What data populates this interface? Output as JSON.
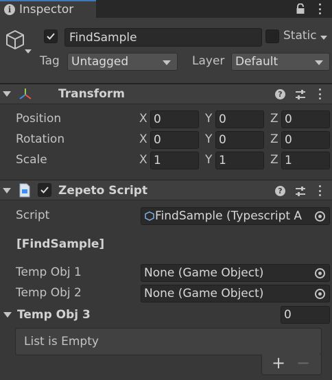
{
  "tab": {
    "title": "Inspector"
  },
  "header": {
    "object_name": "FindSample",
    "static_label": "Static",
    "tag_label": "Tag",
    "tag_value": "Untagged",
    "layer_label": "Layer",
    "layer_value": "Default"
  },
  "transform": {
    "title": "Transform",
    "rows": [
      {
        "label": "Position",
        "x": "0",
        "y": "0",
        "z": "0"
      },
      {
        "label": "Rotation",
        "x": "0",
        "y": "0",
        "z": "0"
      },
      {
        "label": "Scale",
        "x": "1",
        "y": "1",
        "z": "1"
      }
    ],
    "axis_x": "X",
    "axis_y": "Y",
    "axis_z": "Z"
  },
  "zepeto": {
    "title": "Zepeto Script",
    "script_label": "Script",
    "script_value": "FindSample (Typescript A",
    "section_title": "[FindSample]",
    "fields": [
      {
        "label": "Temp Obj 1",
        "value": "None (Game Object)"
      },
      {
        "label": "Temp Obj 2",
        "value": "None (Game Object)"
      }
    ],
    "list_label": "Temp Obj 3",
    "list_size": "0",
    "list_empty": "List is Empty",
    "add_glyph": "+",
    "remove_glyph": "−"
  }
}
